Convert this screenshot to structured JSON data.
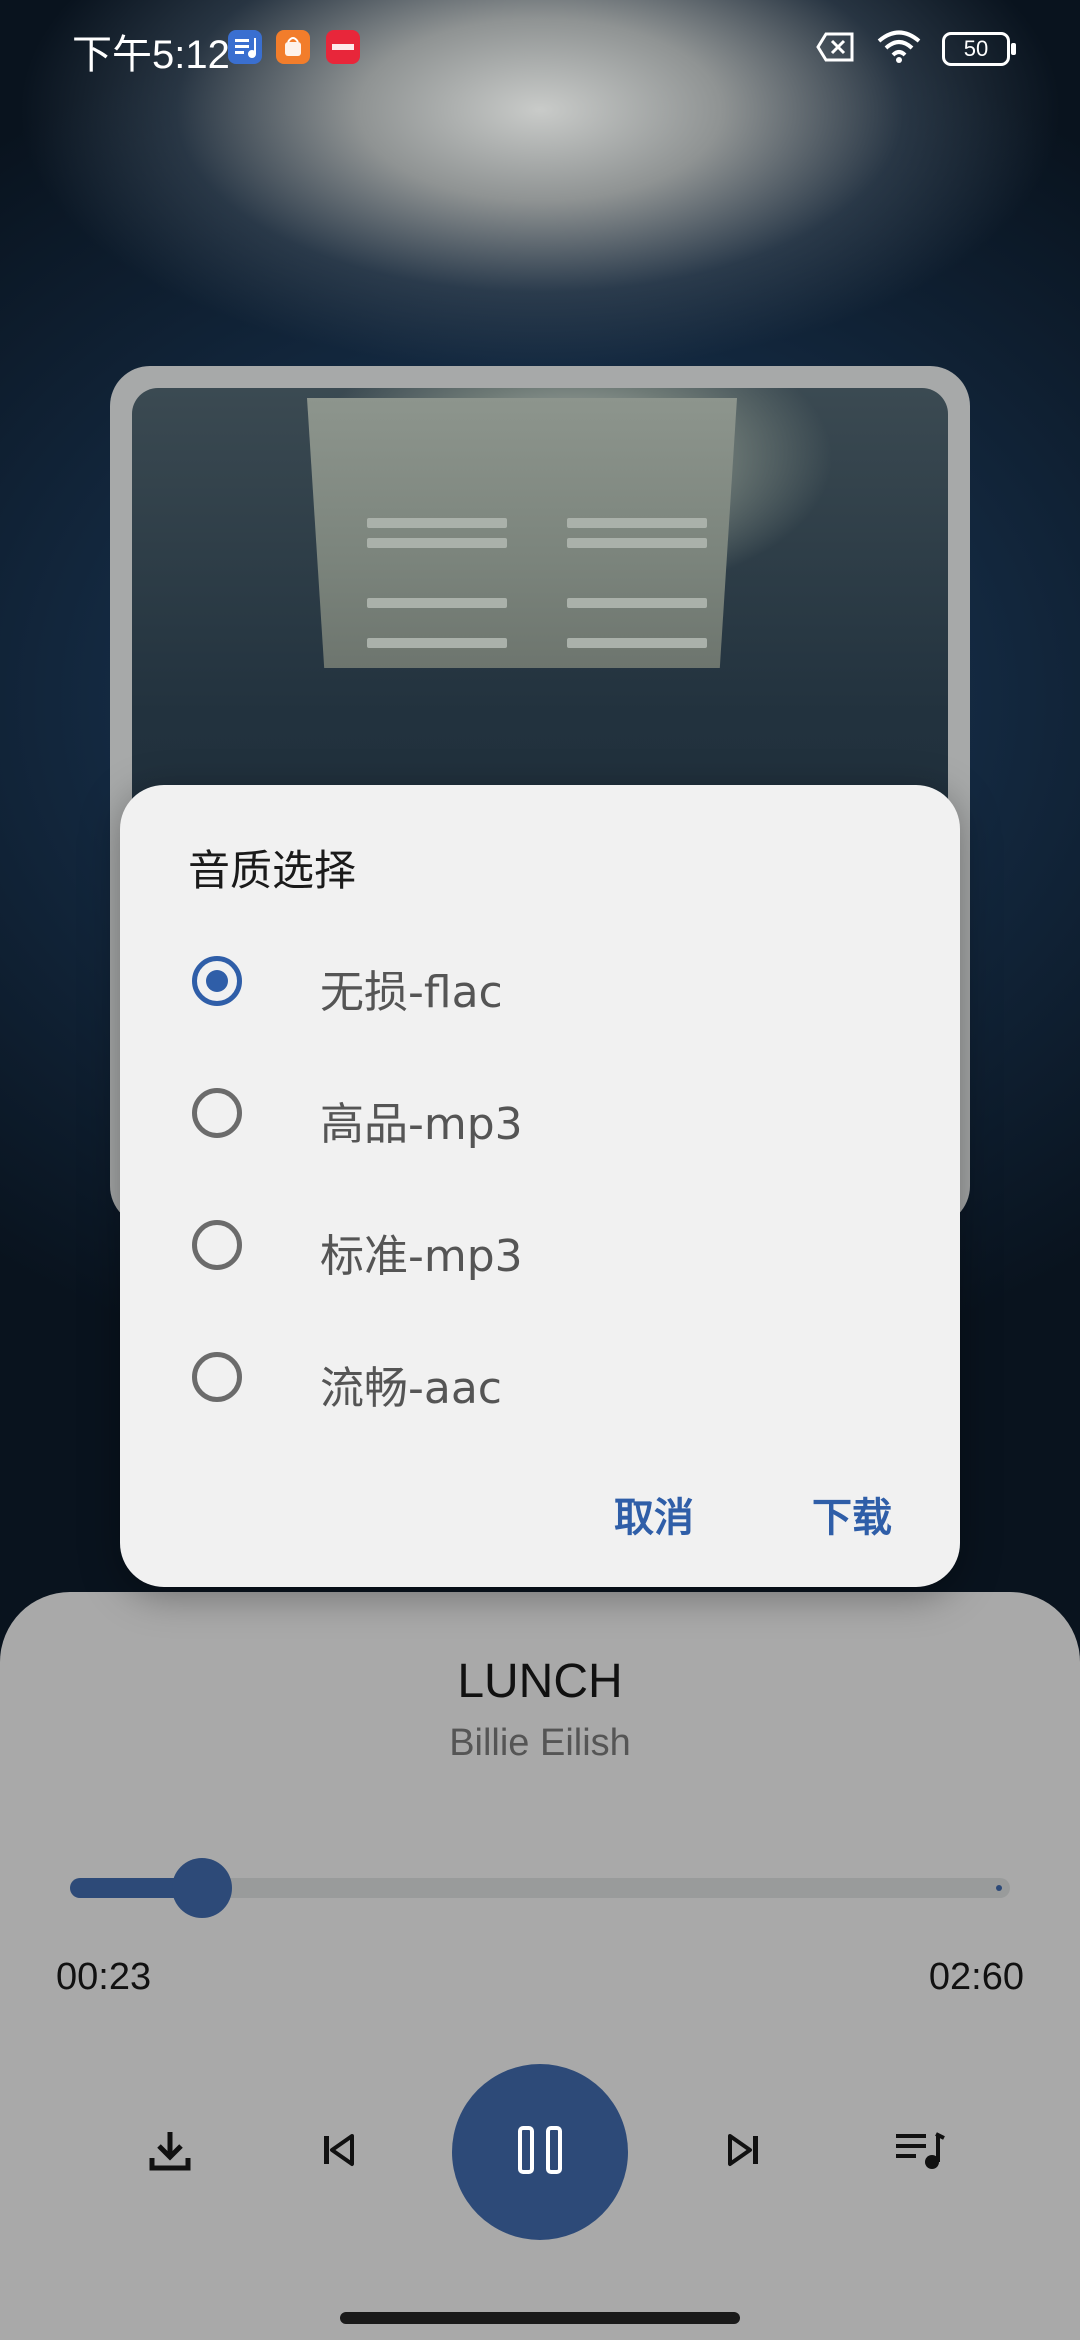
{
  "status_bar": {
    "time": "下午5:12",
    "notif_icons": [
      "music-app-icon",
      "shopping-app-icon",
      "xiaohongshu-app-icon"
    ],
    "battery": "50"
  },
  "player": {
    "song_title": "LUNCH",
    "artist": "Billie Eilish",
    "current_time": "00:23",
    "total_time": "02:60",
    "progress_fraction": 0.14,
    "controls": [
      "download-icon",
      "previous-icon",
      "pause-icon",
      "next-icon",
      "playlist-icon"
    ]
  },
  "dialog": {
    "title": "音质选择",
    "options": [
      {
        "label": "无损-flac",
        "selected": true
      },
      {
        "label": "高品-mp3",
        "selected": false
      },
      {
        "label": "标准-mp3",
        "selected": false
      },
      {
        "label": "流畅-aac",
        "selected": false
      }
    ],
    "cancel_label": "取消",
    "confirm_label": "下载"
  },
  "colors": {
    "accent": "#2f5ea8",
    "player_accent": "#2d4a78",
    "panel_bg": "#a9a9a9",
    "dialog_bg": "#f1f1f1"
  }
}
